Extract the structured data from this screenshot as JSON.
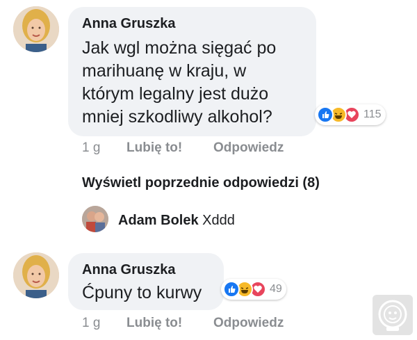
{
  "comments": [
    {
      "author": "Anna Gruszka",
      "lines": [
        "Jak wgl można sięgać po",
        "marihuanę w kraju, w",
        "którym legalny jest dużo",
        "mniej szkodliwy alkohol?"
      ],
      "reactions": {
        "icons": [
          "like-icon",
          "haha-icon",
          "love-icon"
        ],
        "count": "115"
      },
      "time": "1 g",
      "like_label": "Lubię to!",
      "reply_label": "Odpowiedz"
    },
    {
      "author": "Anna Gruszka",
      "lines": [
        "Ćpuny to kurwy"
      ],
      "reactions": {
        "icons": [
          "like-icon",
          "haha-icon",
          "love-icon"
        ],
        "count": "49"
      },
      "time": "1 g",
      "like_label": "Lubię to!",
      "reply_label": "Odpowiedz"
    }
  ],
  "previous_replies_link": "Wyświetl poprzednie odpowiedzi (8)",
  "reply": {
    "author": "Adam Bolek",
    "text": "Xddd"
  },
  "colors": {
    "bubble": "#f0f2f5",
    "text": "#1c1e21",
    "muted": "#8a8d91",
    "like": "#1877f2",
    "haha": "#f7b928",
    "love": "#e8455c"
  }
}
